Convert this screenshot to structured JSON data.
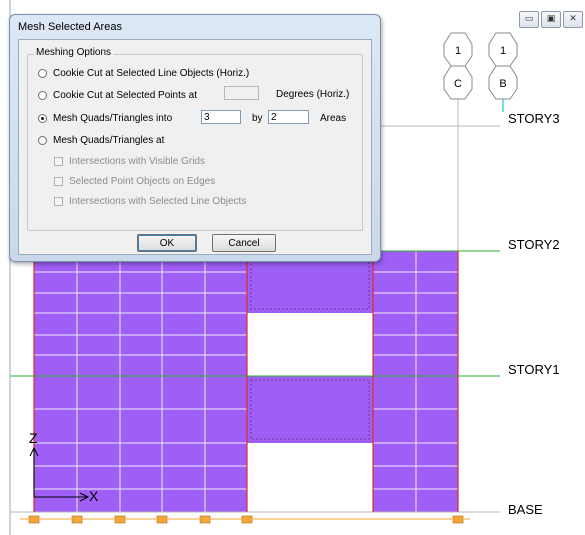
{
  "colors": {
    "area_fill": "#9f5ff7",
    "frame_line": "#e02a2a",
    "story_line": "#2bb02b",
    "grid_line": "#b8b8b8"
  },
  "window_controls": {
    "minimize": "▭",
    "restore": "▣",
    "close": "✕"
  },
  "grid_bubbles": [
    {
      "top": "1",
      "bottom": "C"
    },
    {
      "top": "1",
      "bottom": "B"
    }
  ],
  "story_levels": [
    "STORY3",
    "STORY2",
    "STORY1",
    "BASE"
  ],
  "axes": {
    "z": "Z",
    "x": "X"
  },
  "dialog": {
    "title": "Mesh Selected Areas",
    "group_label": "Meshing Options",
    "options": {
      "cookie_cut_lines": "Cookie Cut at Selected Line Objects (Horiz.)",
      "cookie_cut_points": "Cookie Cut at Selected Points at",
      "degrees_suffix": "Degrees (Horiz.)",
      "degrees_value": "",
      "mesh_into": "Mesh Quads/Triangles into",
      "mesh_into_x": "3",
      "by_label": "by",
      "mesh_into_y": "2",
      "areas_suffix": "Areas",
      "mesh_at": "Mesh Quads/Triangles at",
      "intersections_grids": "Intersections with Visible Grids",
      "selected_points": "Selected Point Objects on Edges",
      "intersections_lines": "Intersections with Selected Line Objects"
    },
    "selected_option": "mesh_into",
    "ok_label": "OK",
    "cancel_label": "Cancel"
  }
}
